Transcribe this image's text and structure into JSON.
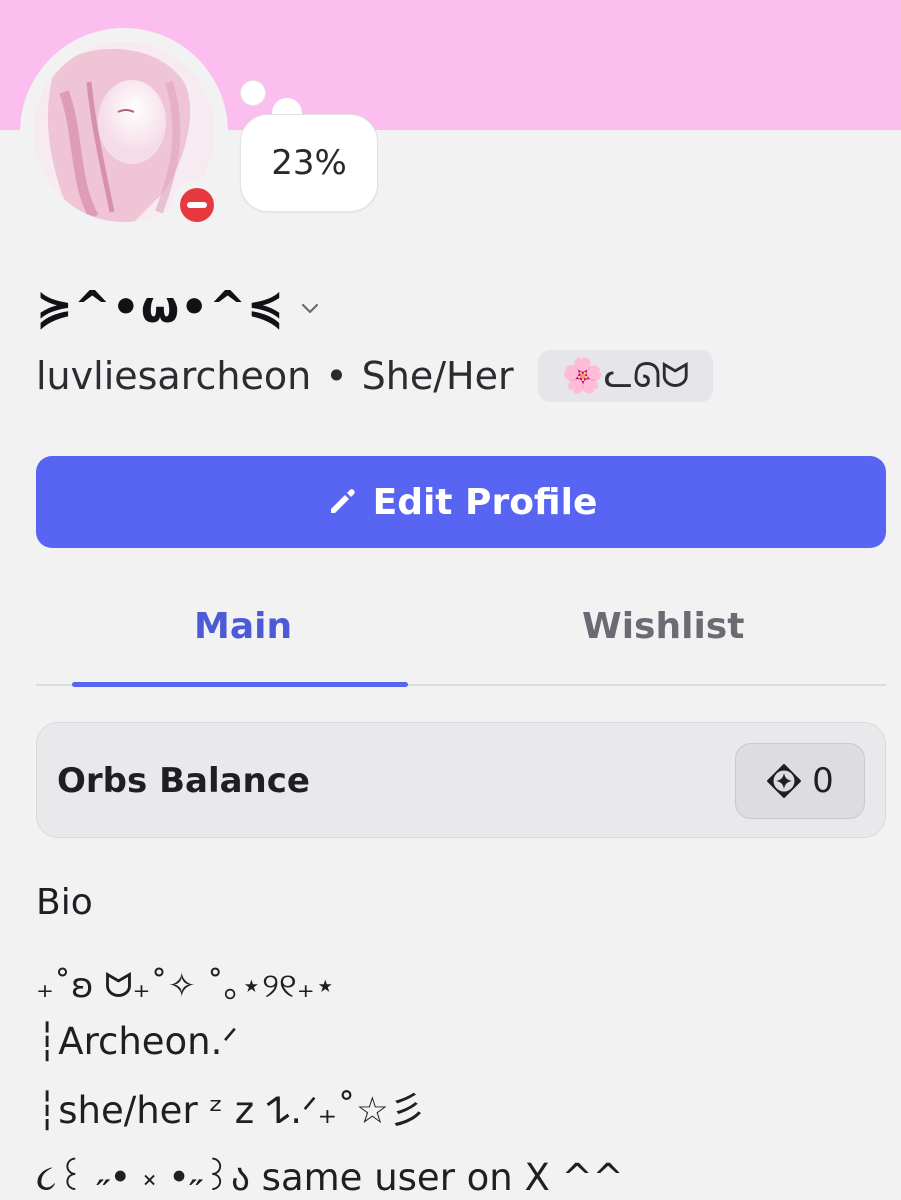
{
  "colors": {
    "banner": "#fcbdef",
    "accent": "#5865f2",
    "tab_active": "#4c5ad6",
    "status_dnd": "#e5393f"
  },
  "status_bubble": {
    "text": "23%"
  },
  "profile": {
    "display_name": "≽^•ω•^≼",
    "username": "luvliesarcheon",
    "separator": "•",
    "pronouns": "She/Her",
    "tag": "🌸ᓚᘏᗢ",
    "status": "do-not-disturb"
  },
  "actions": {
    "edit_profile_label": "Edit Profile",
    "edit_icon": "pencil-icon"
  },
  "tabs": [
    {
      "label": "Main",
      "active": true
    },
    {
      "label": "Wishlist",
      "active": false
    }
  ],
  "orbs": {
    "label": "Orbs Balance",
    "value": "0",
    "icon": "orb-icon"
  },
  "bio": {
    "heading": "Bio",
    "lines": [
      "₊˚ʚ ᗢ₊˚✧ ˚｡⋆୨୧₊⋆",
      "┆Archeon.ᐟ",
      "┆she/her  ᶻ 𝗓 𐰁.ᐟ₊˚☆彡",
      "૮꒰ ˶• ༝ •˶꒱ა same user on X ^^"
    ]
  }
}
